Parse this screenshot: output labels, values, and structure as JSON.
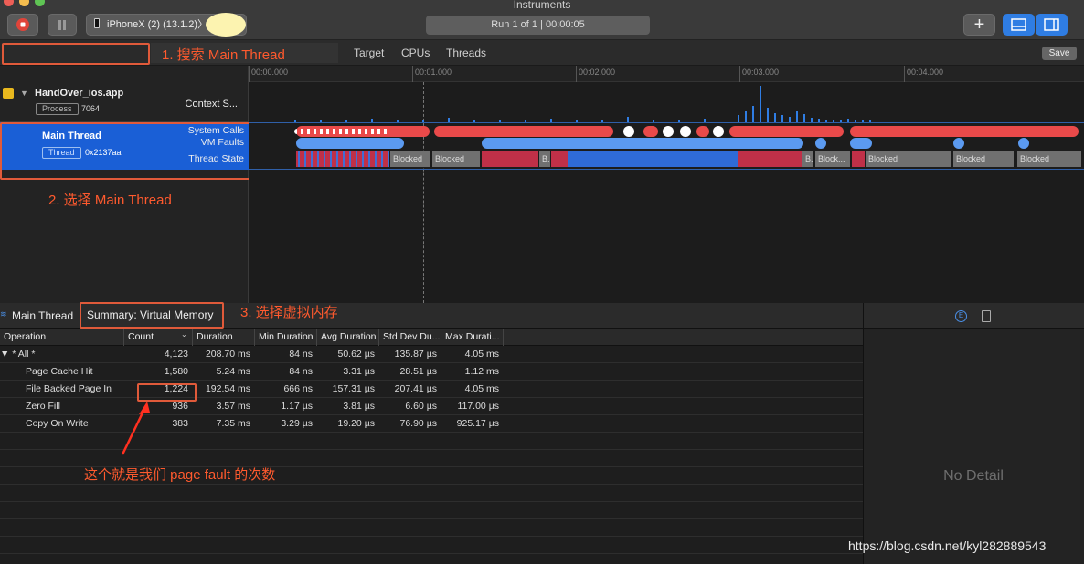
{
  "window": {
    "title": "Instruments"
  },
  "toolbar": {
    "device": "iPhoneX (2) (13.1.2)",
    "device_separator": "〉",
    "run_status": "Run 1 of 1  |  00:00:05",
    "add_icon": "plus-icon",
    "colors": {
      "record": "#e0443a",
      "accent": "#2f7de3"
    }
  },
  "filter": {
    "search_placeholder": "Main Thread",
    "tabs": [
      "Target",
      "CPUs",
      "Threads"
    ],
    "save_label": "Save"
  },
  "annotations": {
    "step1": "1. 搜索 Main Thread",
    "step2": "2. 选择 Main Thread",
    "step3": "3. 选择虚拟内存",
    "note": "这个就是我们 page fault 的次数",
    "color": "#ff5a2e"
  },
  "timeline": {
    "ticks": [
      "00:00.000",
      "00:01.000",
      "00:02.000",
      "00:03.000",
      "00:04.000"
    ]
  },
  "tracks": {
    "process": {
      "name": "HandOver_ios.app",
      "badge": "Process",
      "pid": "7064",
      "lane": "Context S..."
    },
    "thread": {
      "name": "Main Thread",
      "badge": "Thread",
      "tid": "0x2137aa",
      "lanes": [
        "System Calls",
        "VM Faults",
        "Thread State"
      ]
    },
    "state_labels": [
      "Blocked",
      "Blocked",
      "B.",
      "B.",
      "Block...",
      "Blocked",
      "Blocked",
      "Blocked"
    ]
  },
  "bottom": {
    "breadcrumb": "Main Thread",
    "summary": "Summary: Virtual Memory",
    "columns": [
      "Operation",
      "Count",
      "Duration",
      "Min Duration",
      "Avg Duration",
      "Std Dev Du...",
      "Max Durati..."
    ],
    "rows": [
      {
        "op": "▼ * All *",
        "count": "4,123",
        "dur": "208.70 ms",
        "min": "84 ns",
        "avg": "50.62 µs",
        "std": "135.87 µs",
        "max": "4.05 ms"
      },
      {
        "op": "Page Cache Hit",
        "count": "1,580",
        "dur": "5.24 ms",
        "min": "84 ns",
        "avg": "3.31 µs",
        "std": "28.51 µs",
        "max": "1.12 ms"
      },
      {
        "op": "File Backed Page In",
        "count": "1,224",
        "dur": "192.54 ms",
        "min": "666 ns",
        "avg": "157.31 µs",
        "std": "207.41 µs",
        "max": "4.05 ms"
      },
      {
        "op": "Zero Fill",
        "count": "936",
        "dur": "3.57 ms",
        "min": "1.17 µs",
        "avg": "3.81 µs",
        "std": "6.60 µs",
        "max": "117.00 µs"
      },
      {
        "op": "Copy On Write",
        "count": "383",
        "dur": "7.35 ms",
        "min": "3.29 µs",
        "avg": "19.20 µs",
        "std": "76.90 µs",
        "max": "925.17 µs"
      }
    ]
  },
  "detail": {
    "empty": "No Detail"
  },
  "watermark": "https://blog.csdn.net/kyl282889543"
}
